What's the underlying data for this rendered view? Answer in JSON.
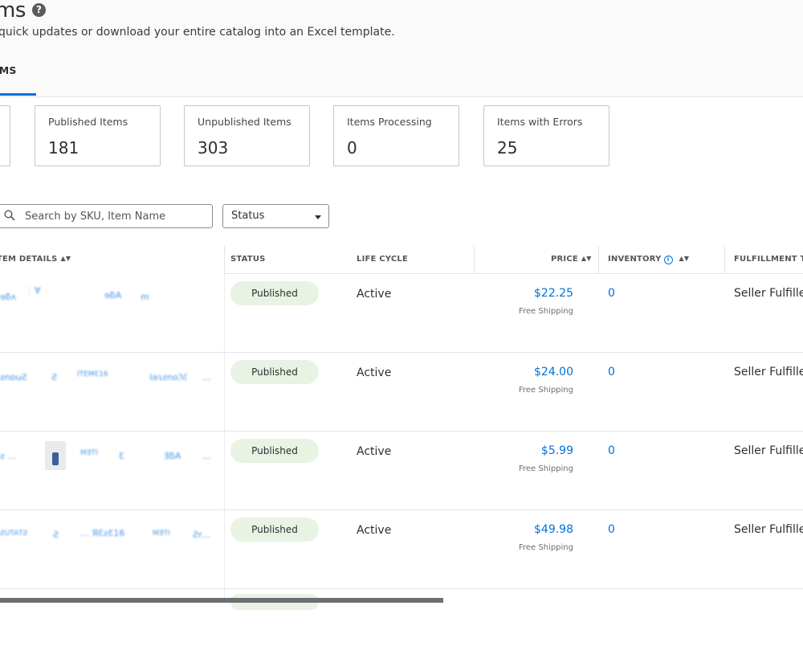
{
  "header": {
    "title": "ms",
    "subtitle": "quick updates or download your entire catalog into an Excel template.",
    "tab_label": "EMS"
  },
  "summary_cards": [
    {
      "label": "Published Items",
      "value": "181"
    },
    {
      "label": "Unpublished Items",
      "value": "303"
    },
    {
      "label": "Items Processing",
      "value": "0"
    },
    {
      "label": "Items with Errors",
      "value": "25"
    }
  ],
  "filters": {
    "search_placeholder": "Search by SKU, Item Name",
    "status_label": "Status"
  },
  "table": {
    "columns": {
      "item_details": "TEM DETAILS",
      "status": "STATUS",
      "life_cycle": "LIFE CYCLE",
      "price": "PRICE",
      "inventory": "INVENTORY",
      "fulfillment": "FULFILLMENT TYPE"
    },
    "rows": [
      {
        "status": "Published",
        "life_cycle": "Active",
        "price": "$22.25",
        "shipping": "Free Shipping",
        "inventory": "0",
        "fulfillment": "Seller Fulfilled"
      },
      {
        "status": "Published",
        "life_cycle": "Active",
        "price": "$24.00",
        "shipping": "Free Shipping",
        "inventory": "0",
        "fulfillment": "Seller Fulfilled"
      },
      {
        "status": "Published",
        "life_cycle": "Active",
        "price": "$5.99",
        "shipping": "Free Shipping",
        "inventory": "0",
        "fulfillment": "Seller Fulfilled"
      },
      {
        "status": "Published",
        "life_cycle": "Active",
        "price": "$49.98",
        "shipping": "Free Shipping",
        "inventory": "0",
        "fulfillment": "Seller Fulfilled"
      }
    ]
  },
  "colors": {
    "accent": "#0071dc",
    "pill_bg": "#e8f3e4"
  },
  "icons": [
    "help-icon",
    "search-icon",
    "caret-down-icon",
    "sort-icon",
    "info-icon"
  ]
}
